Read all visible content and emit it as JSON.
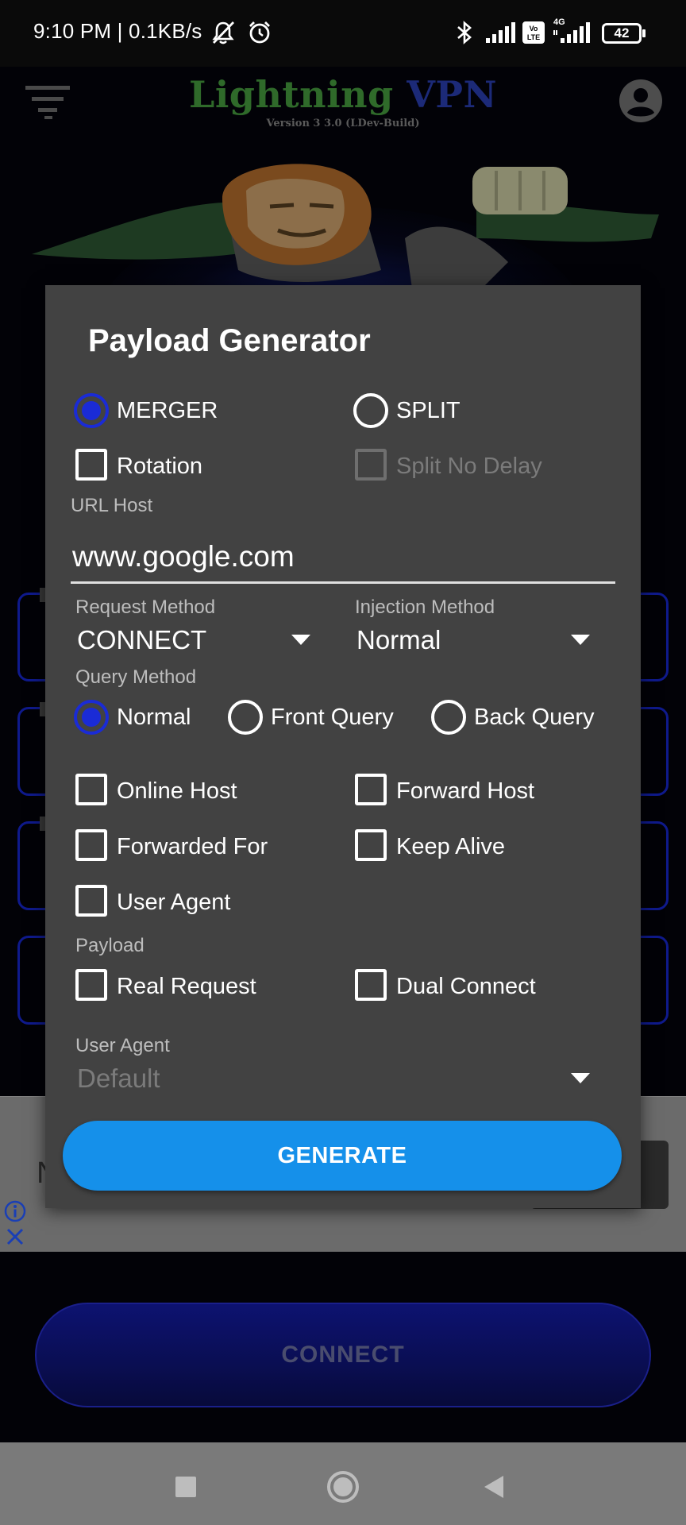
{
  "status_bar": {
    "time": "9:10 PM | 0.1KB/s",
    "network_label": "4G",
    "volte_label": "Vo LTE",
    "battery": "42"
  },
  "app": {
    "title_part1": "Lightning",
    "title_part2": "VPN",
    "version": "Version 3 3.0 (LDev-Build)",
    "menu_icon": "menu-icon",
    "account_icon": "account-circle-icon",
    "connect_label": "CONNECT",
    "colors": {
      "title_green": "#2f6a2a",
      "title_blue": "#1c2a78",
      "accent_blue": "#1590ea",
      "radio_blue": "#1a2bd6"
    }
  },
  "ad": {
    "letter": "N",
    "info_icon": "info-icon",
    "close_icon": "close-icon"
  },
  "dialog": {
    "title": "Payload Generator",
    "mode_options": [
      {
        "label": "MERGER",
        "selected": true
      },
      {
        "label": "SPLIT",
        "selected": false
      }
    ],
    "rotation_label": "Rotation",
    "split_no_delay_label": "Split No Delay",
    "url_host": {
      "label": "URL Host",
      "value": "www.google.com"
    },
    "request_method": {
      "label": "Request Method",
      "value": "CONNECT"
    },
    "injection_method": {
      "label": "Injection Method",
      "value": "Normal"
    },
    "query_method": {
      "label": "Query Method",
      "options": [
        "Normal",
        "Front Query",
        "Back Query"
      ],
      "selected": "Normal"
    },
    "header_options": {
      "online_host": "Online Host",
      "forward_host": "Forward Host",
      "forwarded_for": "Forwarded For",
      "keep_alive": "Keep Alive",
      "user_agent": "User Agent"
    },
    "payload": {
      "label": "Payload",
      "real_request": "Real Request",
      "dual_connect": "Dual Connect"
    },
    "user_agent_select": {
      "label": "User Agent",
      "value": "Default"
    },
    "generate_label": "GENERATE"
  },
  "nav_bar": {
    "recents_icon": "recents-square-icon",
    "home_icon": "home-circle-icon",
    "back_icon": "back-triangle-icon"
  }
}
